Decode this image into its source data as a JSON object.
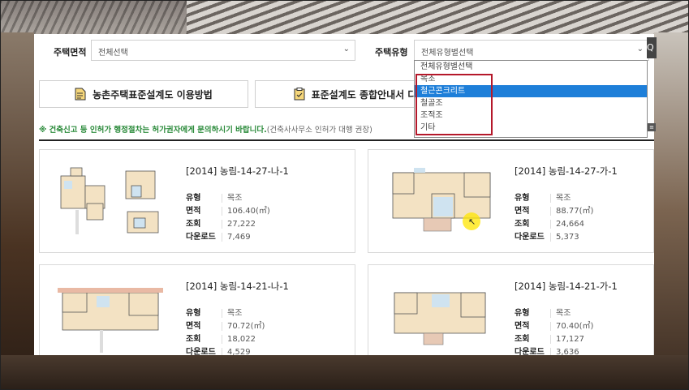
{
  "filters": {
    "area_label": "주택면적",
    "area_value": "전체선택",
    "type_label": "주택유형",
    "type_value": "전체유형별선택"
  },
  "dropdown": {
    "options": [
      "전체유형별선택",
      "목조",
      "철근콘크리트",
      "철골조",
      "조적조",
      "기타"
    ],
    "selected_index": 2
  },
  "buttons": {
    "guide": "농촌주택표준설계도 이용방법",
    "overview": "표준설계도 종합안내서 다운"
  },
  "notice": {
    "main": "※ 건축신고 등 인허가 행정절차는 허가권자에게 문의하시기 바랍니다.",
    "sub": "(건축사사무소 인허가 대행 권장)"
  },
  "field_labels": {
    "type": "유형",
    "area": "면적",
    "views": "조회",
    "downloads": "다운로드"
  },
  "cards": [
    {
      "title": "[2014] 농림-14-27-나-1",
      "type": "목조",
      "area": "106.40(㎡)",
      "views": "27,222",
      "downloads": "7,469"
    },
    {
      "title": "[2014] 농림-14-27-가-1",
      "type": "목조",
      "area": "88.77(㎡)",
      "views": "24,664",
      "downloads": "5,373"
    },
    {
      "title": "[2014] 농림-14-21-나-1",
      "type": "목조",
      "area": "70.72(㎡)",
      "views": "18,022",
      "downloads": "4,529"
    },
    {
      "title": "[2014] 농림-14-21-가-1",
      "type": "목조",
      "area": "70.40(㎡)",
      "views": "17,127",
      "downloads": "3,636"
    }
  ],
  "colors": {
    "accent": "#1e7fd9",
    "highlight": "#b5182a",
    "notice_green": "#2a8a3a"
  }
}
